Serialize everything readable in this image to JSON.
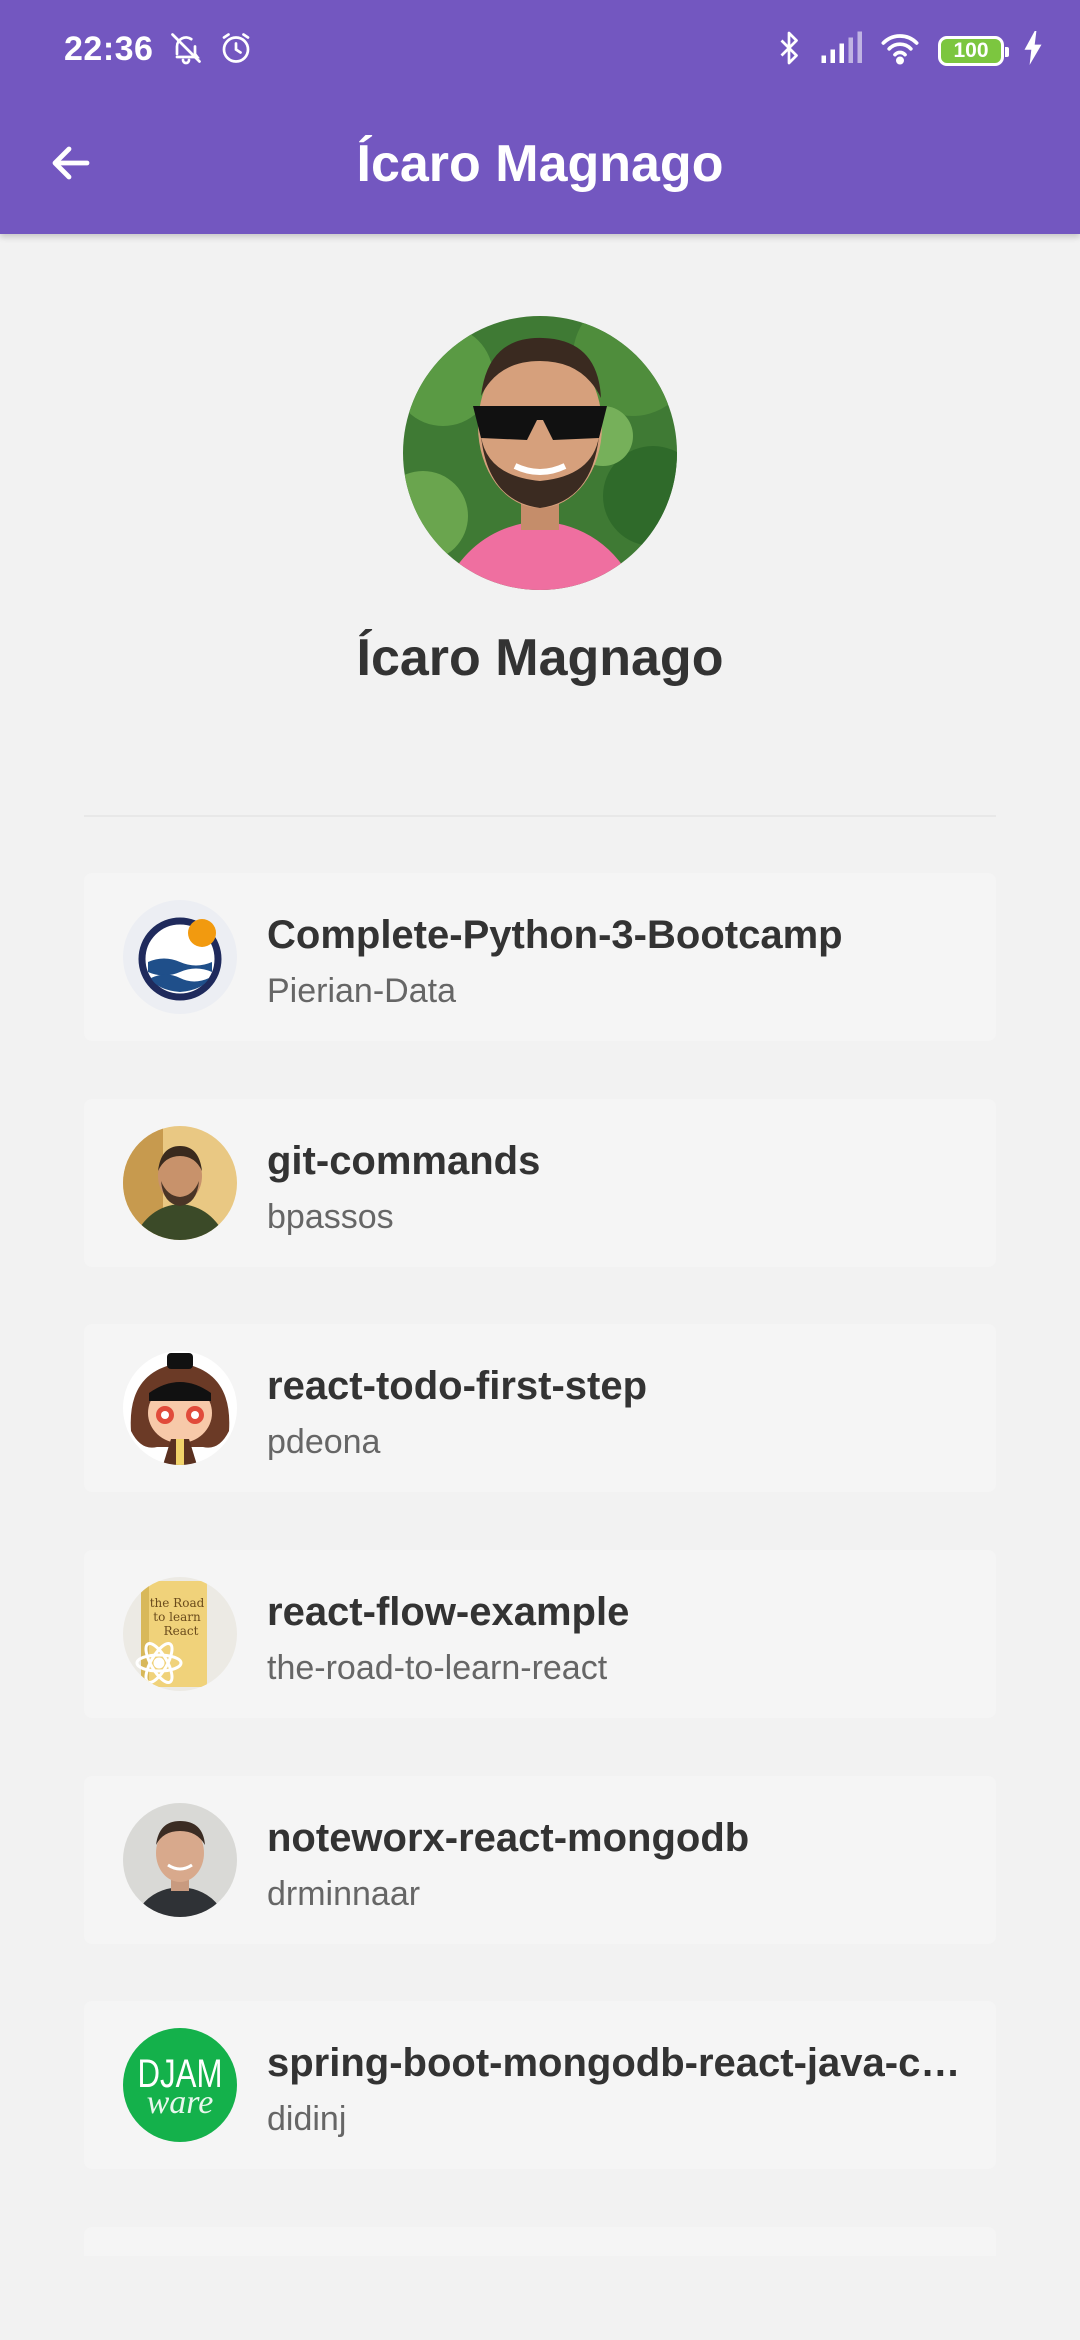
{
  "status_bar": {
    "time": "22:36",
    "battery": "100",
    "icons": [
      "mute-bell-icon",
      "alarm-icon",
      "bluetooth-icon",
      "signal-icon",
      "wifi-icon",
      "battery-icon",
      "charging-icon"
    ]
  },
  "app_bar": {
    "title": "Ícaro Magnago",
    "back_icon": "arrow-back-icon",
    "color": "#7357c0"
  },
  "profile": {
    "name": "Ícaro Magnago"
  },
  "repositories": [
    {
      "name": "Complete-Python-3-Bootcamp",
      "owner": "Pierian-Data"
    },
    {
      "name": "git-commands",
      "owner": "bpassos"
    },
    {
      "name": "react-todo-first-step",
      "owner": "pdeona"
    },
    {
      "name": "react-flow-example",
      "owner": "the-road-to-learn-react"
    },
    {
      "name": "noteworx-react-mongodb",
      "owner": "drminnaar"
    },
    {
      "name": "spring-boot-mongodb-react-java-crud",
      "owner": "didinj"
    }
  ],
  "djam_avatar": {
    "top": "DJAM",
    "bottom": "ware"
  }
}
